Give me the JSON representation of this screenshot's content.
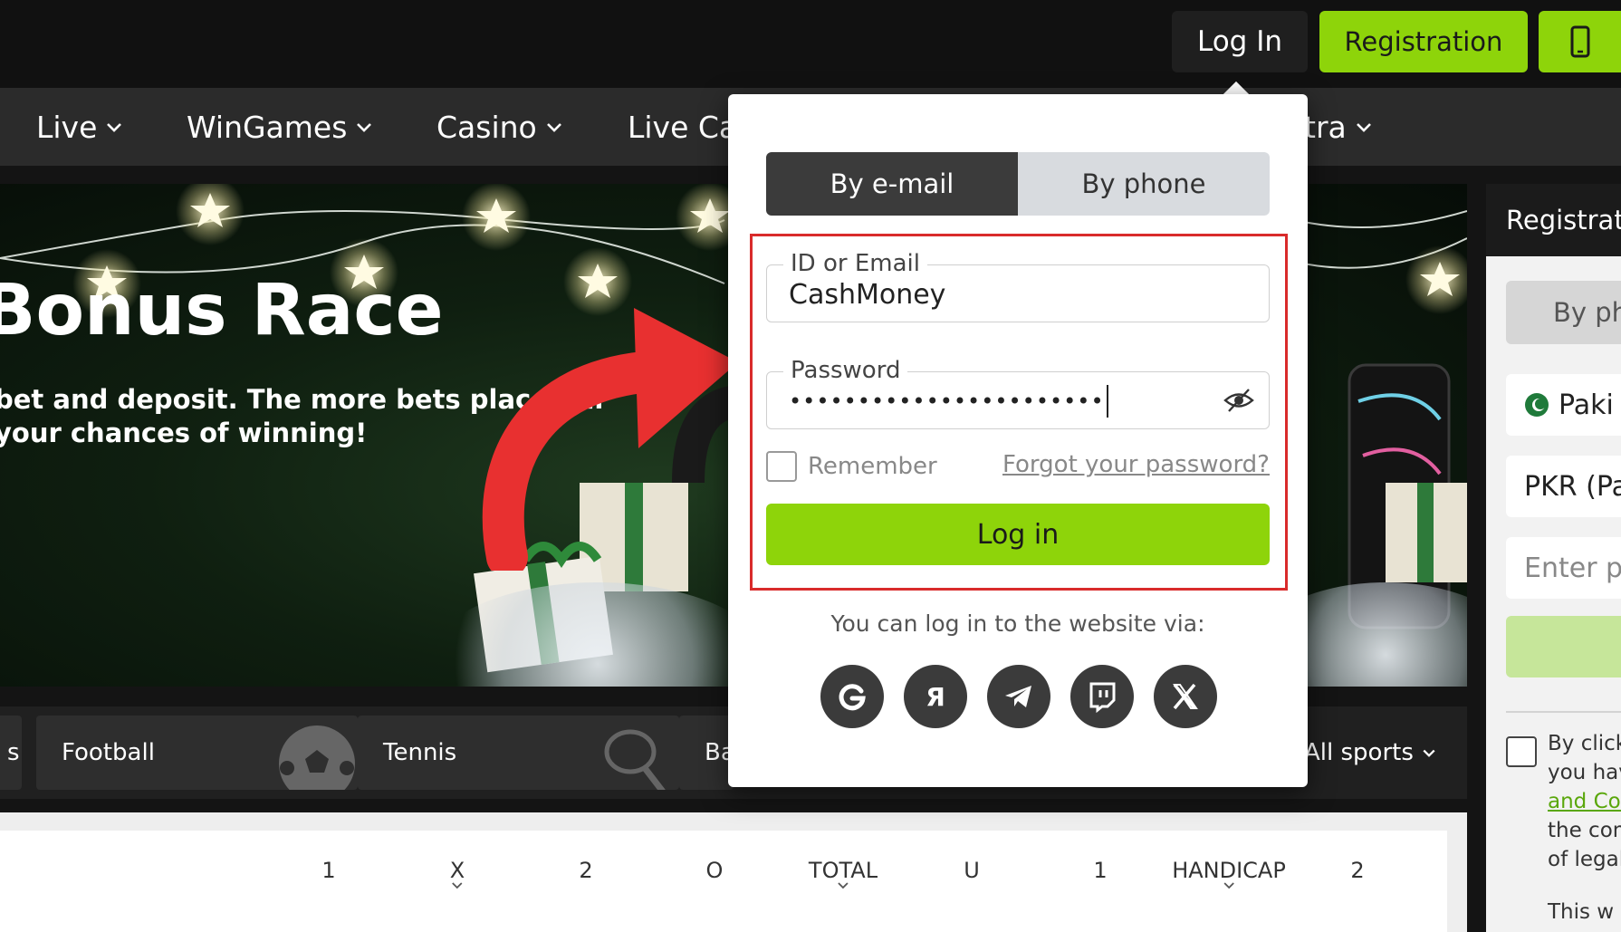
{
  "topbar": {
    "login_label": "Log In",
    "register_label": "Registration",
    "mobile_icon": "smartphone-icon"
  },
  "nav": {
    "items": [
      {
        "label": "Live"
      },
      {
        "label": "WinGames"
      },
      {
        "label": "Casino"
      },
      {
        "label": "Live Ca"
      },
      {
        "label": "tra"
      }
    ]
  },
  "hero": {
    "title": "Bonus Race",
    "subtitle_line1": "bet and deposit. The more bets placed ar",
    "subtitle_line2": "your chances of winning!"
  },
  "login_popup": {
    "tabs": [
      {
        "label": "By e-mail",
        "active": true
      },
      {
        "label": "By phone",
        "active": false
      }
    ],
    "id_field": {
      "label": "ID or Email",
      "value": "CashMoney"
    },
    "password_field": {
      "label": "Password",
      "value": "•••••••••••••••••••••••"
    },
    "remember_label": "Remember",
    "forgot_label": "Forgot your password?",
    "login_button": "Log in",
    "via_text": "You can log in to the website via:",
    "social": [
      "google-icon",
      "yandex-icon",
      "telegram-icon",
      "twitch-icon",
      "x-icon"
    ]
  },
  "registration_panel": {
    "title": "Registrat",
    "tab_label": "By ph",
    "country": "Paki",
    "currency": "PKR (Pa",
    "input_placeholder": "Enter p",
    "terms_lines": [
      "By click",
      "you hav",
      "and Cor",
      "the com",
      "of legal",
      "This w"
    ]
  },
  "sports": {
    "items": [
      {
        "label": "s"
      },
      {
        "label": "Football"
      },
      {
        "label": "Tennis"
      },
      {
        "label": "Ba"
      }
    ],
    "all_label": "All sports"
  },
  "odds_table": {
    "columns": [
      "1",
      "X",
      "2",
      "O",
      "TOTAL",
      "U",
      "1",
      "HANDICAP",
      "2"
    ]
  },
  "colors": {
    "accent_green": "#8ed40a",
    "highlight_red": "#d92b2b",
    "dark_bg": "#111111"
  }
}
